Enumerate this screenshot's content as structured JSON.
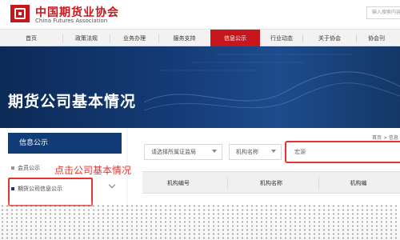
{
  "header": {
    "org_name_cn": "中国期货业协会",
    "org_name_en": "China Futures Association",
    "search_placeholder": "输入搜索内容"
  },
  "nav": {
    "items": [
      {
        "label": "首页"
      },
      {
        "label": "政策法规"
      },
      {
        "label": "业务办理"
      },
      {
        "label": "服务支持"
      },
      {
        "label": "信息公示"
      },
      {
        "label": "行业动态"
      },
      {
        "label": "关于协会"
      },
      {
        "label": "协会刊"
      }
    ],
    "active_index": 4
  },
  "banner": {
    "title": "期货公司基本情况"
  },
  "breadcrumb": "首页 > 信息",
  "sidebar": {
    "header": "信息公示",
    "items": [
      {
        "label": "会员公示"
      },
      {
        "label": "期货公司信息公示"
      }
    ],
    "annotation": "点击公司基本情况"
  },
  "filters": {
    "exchange": "请选择所属证监局",
    "field": "机构名称",
    "search_value": "宏源"
  },
  "table": {
    "columns": [
      "机构编号",
      "机构名称",
      "机构编"
    ]
  },
  "colors": {
    "brand_red": "#c8161d",
    "nav_active": "#c8161d",
    "sidebar_header": "#123c77",
    "highlight_red": "#e5332f"
  }
}
